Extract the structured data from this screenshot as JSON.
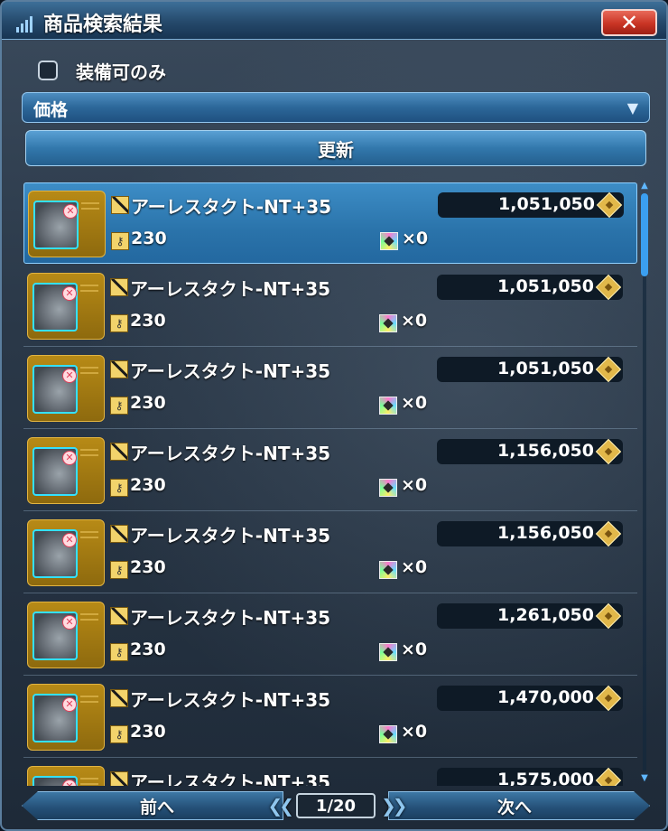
{
  "window": {
    "title": "商品検索結果",
    "close_label": "✕"
  },
  "filters": {
    "equip_only_label": "装備可のみ",
    "equip_only_checked": false,
    "sort_selected": "価格",
    "refresh_label": "更新"
  },
  "results": [
    {
      "name": "アーレスタクト-NT+35",
      "price": "1,051,050",
      "requirement": "230",
      "slots": "×0"
    },
    {
      "name": "アーレスタクト-NT+35",
      "price": "1,051,050",
      "requirement": "230",
      "slots": "×0"
    },
    {
      "name": "アーレスタクト-NT+35",
      "price": "1,051,050",
      "requirement": "230",
      "slots": "×0"
    },
    {
      "name": "アーレスタクト-NT+35",
      "price": "1,156,050",
      "requirement": "230",
      "slots": "×0"
    },
    {
      "name": "アーレスタクト-NT+35",
      "price": "1,156,050",
      "requirement": "230",
      "slots": "×0"
    },
    {
      "name": "アーレスタクト-NT+35",
      "price": "1,261,050",
      "requirement": "230",
      "slots": "×0"
    },
    {
      "name": "アーレスタクト-NT+35",
      "price": "1,470,000",
      "requirement": "230",
      "slots": "×0"
    },
    {
      "name": "アーレスタクト-NT+35",
      "price": "1,575,000",
      "requirement": "",
      "slots": ""
    }
  ],
  "footer": {
    "prev_label": "前へ",
    "next_label": "次へ",
    "page_indicator": "1/20"
  },
  "icons": {
    "weapon": "wand-icon",
    "requirement": "key-icon",
    "slot": "slot-gem-icon",
    "currency": "meseta-icon"
  },
  "colors": {
    "accent": "#3b9ff0",
    "selected_row": "#2a73aa",
    "close_button": "#c93424",
    "thumbnail_frame": "#b78a16"
  }
}
